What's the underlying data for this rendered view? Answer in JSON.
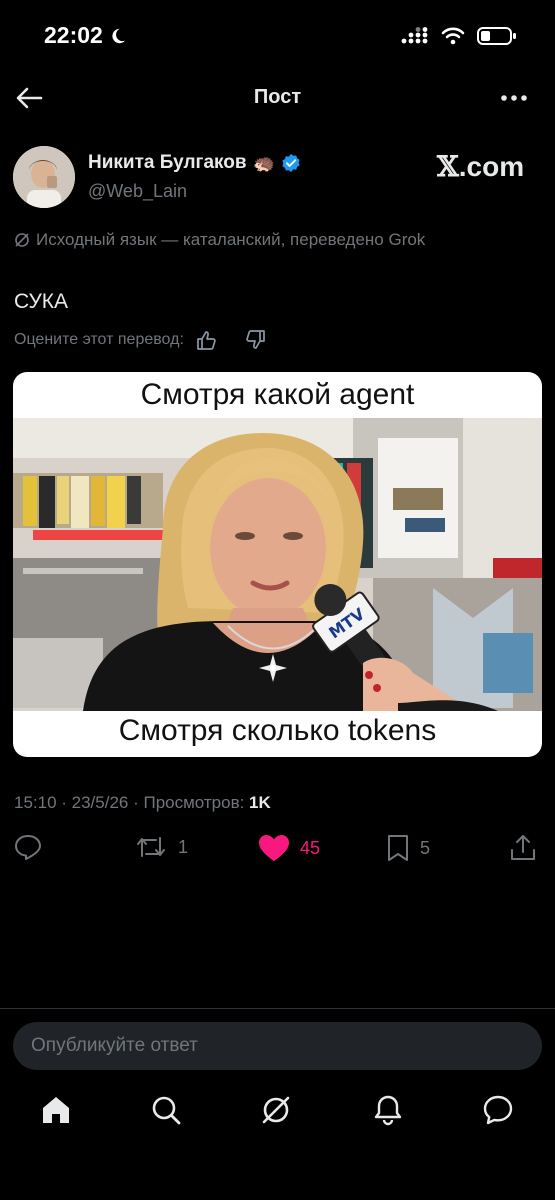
{
  "status_bar": {
    "time": "22:02"
  },
  "header": {
    "title": "Пост"
  },
  "author": {
    "name": "Никита Булгаков",
    "emoji": "🦔",
    "handle": "@Web_Lain"
  },
  "watermark": {
    "logo_text": ".com"
  },
  "translation_note": "Исходный язык — каталанский, переведено Grok",
  "post_text": "СУКА",
  "rate_label": "Оцените этот перевод:",
  "media": {
    "caption_top": "Смотря какой agent",
    "caption_bottom": "Смотря сколько tokens",
    "mic_logo": "MTV"
  },
  "meta": {
    "date": "15:10 · 23/5/26 · Просмотров: ",
    "views": "1K"
  },
  "actions": {
    "retweets": "1",
    "likes": "45",
    "bookmarks": "5"
  },
  "reply_placeholder": "Опубликуйте ответ",
  "colors": {
    "like": "#f91880",
    "verified": "#1d9bf0",
    "muted": "#71767b",
    "background": "#000000"
  }
}
